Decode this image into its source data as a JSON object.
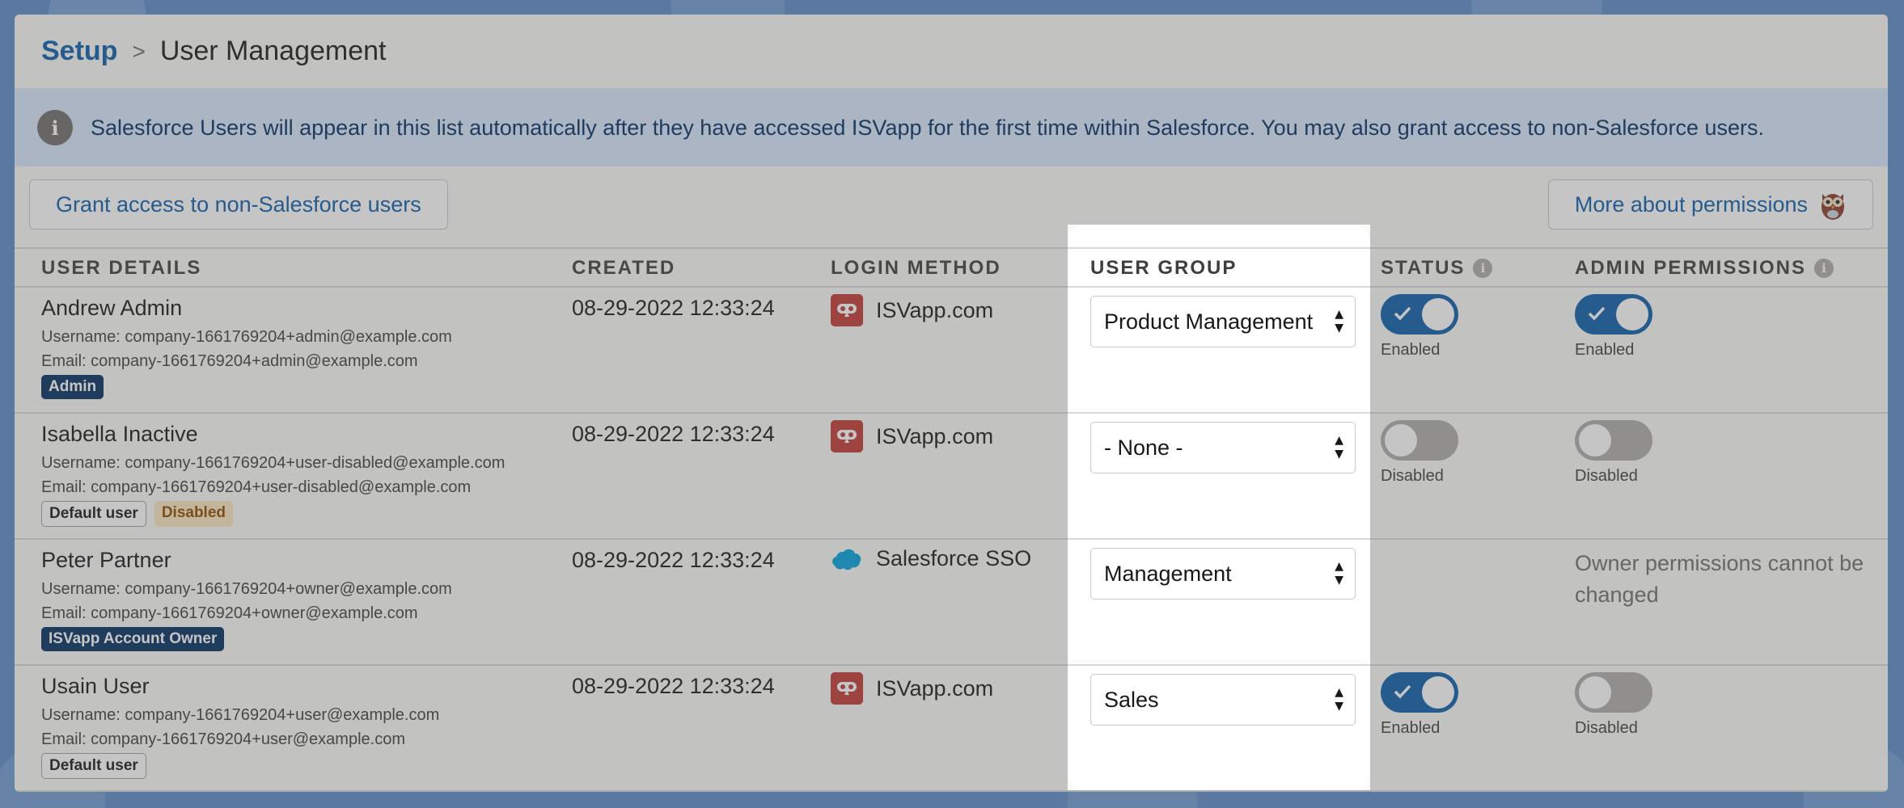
{
  "breadcrumb": {
    "root": "Setup",
    "separator": ">",
    "current": "User Management"
  },
  "banner": {
    "icon": "info-icon",
    "text": "Salesforce Users will appear in this list automatically after they have accessed ISVapp for the first time within Salesforce. You may also grant access to non-Salesforce users."
  },
  "actions": {
    "grant_label": "Grant access to non-Salesforce users",
    "more_label": "More about permissions"
  },
  "columns": {
    "user_details": "USER DETAILS",
    "created": "CREATED",
    "login_method": "LOGIN METHOD",
    "user_group": "USER GROUP",
    "status": "STATUS",
    "admin_permissions": "ADMIN PERMISSIONS"
  },
  "rows": [
    {
      "name": "Andrew Admin",
      "username": "Username: company-1661769204+admin@example.com",
      "email": "Email: company-1661769204+admin@example.com",
      "badges": [
        "Admin"
      ],
      "created": "08-29-2022 12:33:24",
      "login": "ISVapp.com",
      "group": "Product Management",
      "status": "Enabled",
      "admin": "Enabled"
    },
    {
      "name": "Isabella Inactive",
      "username": "Username: company-1661769204+user-disabled@example.com",
      "email": "Email: company-1661769204+user-disabled@example.com",
      "badges": [
        "Default user",
        "Disabled"
      ],
      "created": "08-29-2022 12:33:24",
      "login": "ISVapp.com",
      "group": "- None -",
      "status": "Disabled",
      "admin": "Disabled"
    },
    {
      "name": "Peter Partner",
      "username": "Username: company-1661769204+owner@example.com",
      "email": "Email: company-1661769204+owner@example.com",
      "badges": [
        "ISVapp Account Owner"
      ],
      "created": "08-29-2022 12:33:24",
      "login": "Salesforce SSO",
      "group": "Management",
      "admin_note": "Owner permissions cannot be changed"
    },
    {
      "name": "Usain User",
      "username": "Username: company-1661769204+user@example.com",
      "email": "Email: company-1661769204+user@example.com",
      "badges": [
        "Default user"
      ],
      "created": "08-29-2022 12:33:24",
      "login": "ISVapp.com",
      "group": "Sales",
      "status": "Enabled",
      "admin": "Disabled"
    }
  ],
  "colors": {
    "link": "#0b5cab",
    "toggle_on": "#0b5cab",
    "isvapp_icon": "#c23934"
  }
}
